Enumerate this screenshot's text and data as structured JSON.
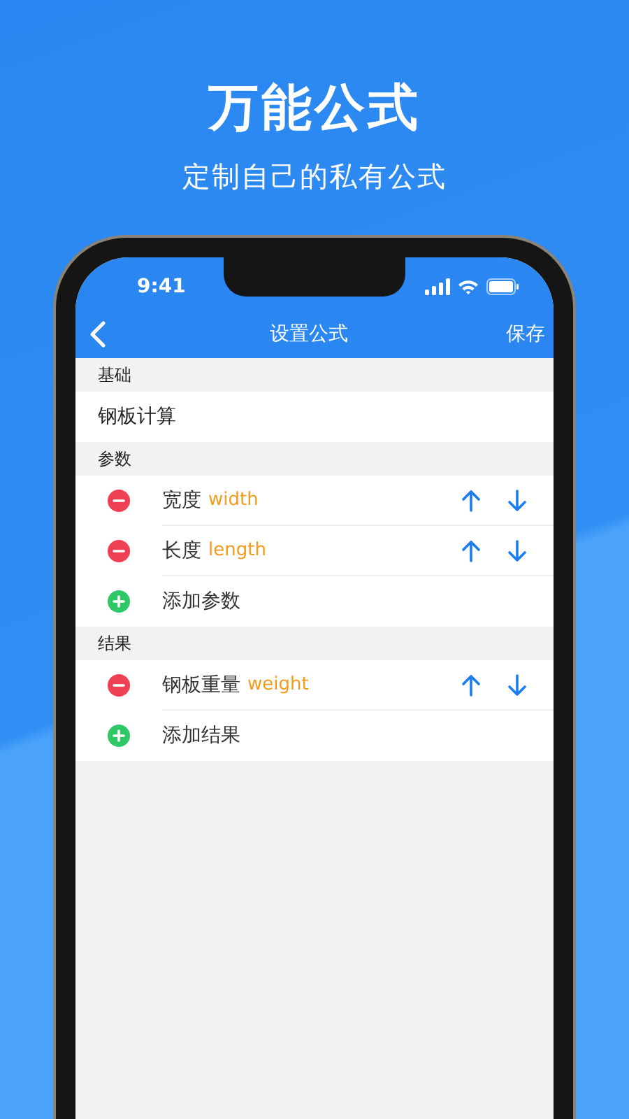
{
  "headline": "万能公式",
  "subtitle": "定制自己的私有公式",
  "status_bar": {
    "time": "9:41"
  },
  "nav": {
    "title": "设置公式",
    "action": "保存"
  },
  "sections": [
    {
      "header": "基础",
      "rows": [
        {
          "kind": "field",
          "value": "钢板计算"
        }
      ]
    },
    {
      "header": "参数",
      "rows": [
        {
          "kind": "item",
          "label": "宽度",
          "variable": "width"
        },
        {
          "kind": "item",
          "label": "长度",
          "variable": "length"
        },
        {
          "kind": "add",
          "label": "添加参数"
        }
      ]
    },
    {
      "header": "结果",
      "rows": [
        {
          "kind": "item",
          "label": "钢板重量",
          "variable": "weight"
        },
        {
          "kind": "add",
          "label": "添加结果"
        }
      ]
    }
  ]
}
